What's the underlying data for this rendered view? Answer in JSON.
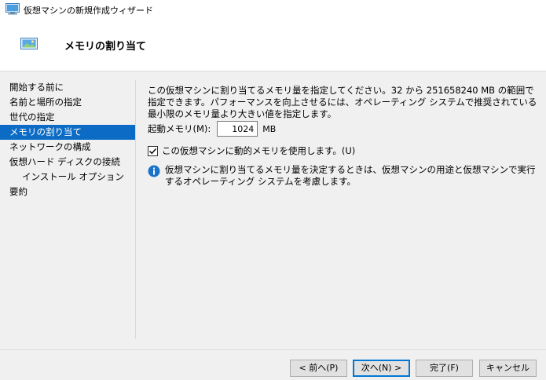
{
  "window": {
    "title": "仮想マシンの新規作成ウィザード"
  },
  "header": {
    "title": "メモリの割り当て"
  },
  "nav": {
    "items": [
      {
        "label": "開始する前に"
      },
      {
        "label": "名前と場所の指定"
      },
      {
        "label": "世代の指定"
      },
      {
        "label": "メモリの割り当て",
        "selected": true
      },
      {
        "label": "ネットワークの構成"
      },
      {
        "label": "仮想ハード ディスクの接続"
      },
      {
        "label": "インストール オプション",
        "sub": true
      },
      {
        "label": "要約"
      }
    ]
  },
  "content": {
    "description": "この仮想マシンに割り当てるメモリ量を指定してください。32 から 251658240 MB の範囲で指定できます。パフォーマンスを向上させるには、オペレーティング システムで推奨されている最小限のメモリ量より大きい値を指定します。",
    "startup_memory_label": "起動メモリ(M):",
    "startup_memory_value": "1024",
    "startup_memory_unit": "MB",
    "dynamic_memory_label": "この仮想マシンに動的メモリを使用します。(U)",
    "dynamic_memory_checked": true,
    "info_text": "仮想マシンに割り当てるメモリ量を決定するときは、仮想マシンの用途と仮想マシンで実行するオペレーティング システムを考慮します。"
  },
  "buttons": {
    "back": "< 前へ(P)",
    "next": "次へ(N) >",
    "finish": "完了(F)",
    "cancel": "キャンセル"
  },
  "colors": {
    "selected_nav": "#0c6bc4",
    "info_icon": "#1a73c9"
  }
}
